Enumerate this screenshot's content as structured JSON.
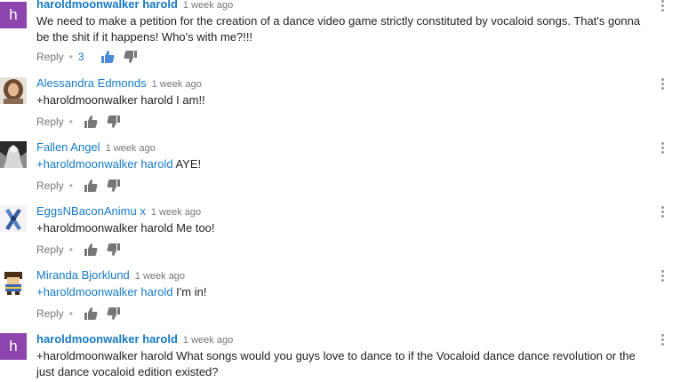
{
  "comments": [
    {
      "author": "haroldmoonwalker harold",
      "avatar_letter": "h",
      "time": "1 week ago",
      "mention": "",
      "text": "We need to make a petition for the creation of a dance video game strictly constituted by vocaloid songs. That's gonna be the shit if it happens! Who's with me?!!!",
      "reply_label": "Reply",
      "likes": "3"
    },
    {
      "author": "Alessandra Edmonds",
      "time": "1 week ago",
      "mention": "",
      "text": "+haroldmoonwalker harold I am!!",
      "reply_label": "Reply"
    },
    {
      "author": "Fallen Angel",
      "time": "1 week ago",
      "mention": "+haroldmoonwalker harold",
      "text": " AYE!",
      "reply_label": "Reply"
    },
    {
      "author": "EggsNBaconAnimu x",
      "time": "1 week ago",
      "mention": "",
      "text": "+haroldmoonwalker harold Me too!",
      "reply_label": "Reply"
    },
    {
      "author": "Miranda Bjorklund",
      "time": "1 week ago",
      "mention": "+haroldmoonwalker harold",
      "text": " I'm in!",
      "reply_label": "Reply"
    },
    {
      "author": "haroldmoonwalker harold",
      "avatar_letter": "h",
      "time": "1 week ago",
      "mention": "",
      "text": "+haroldmoonwalker harold What songs would you guys love to dance to if the Vocaloid dance dance revolution or the just dance vocaloid edition existed?"
    }
  ],
  "colors": {
    "link_blue": "#167ac6",
    "avatar_purple": "#8e44ad",
    "meta_gray": "#767676",
    "body_text": "#222222"
  },
  "icons": {
    "like": "thumbs-up-icon",
    "dislike": "thumbs-down-icon",
    "menu": "vertical-dots-icon"
  }
}
